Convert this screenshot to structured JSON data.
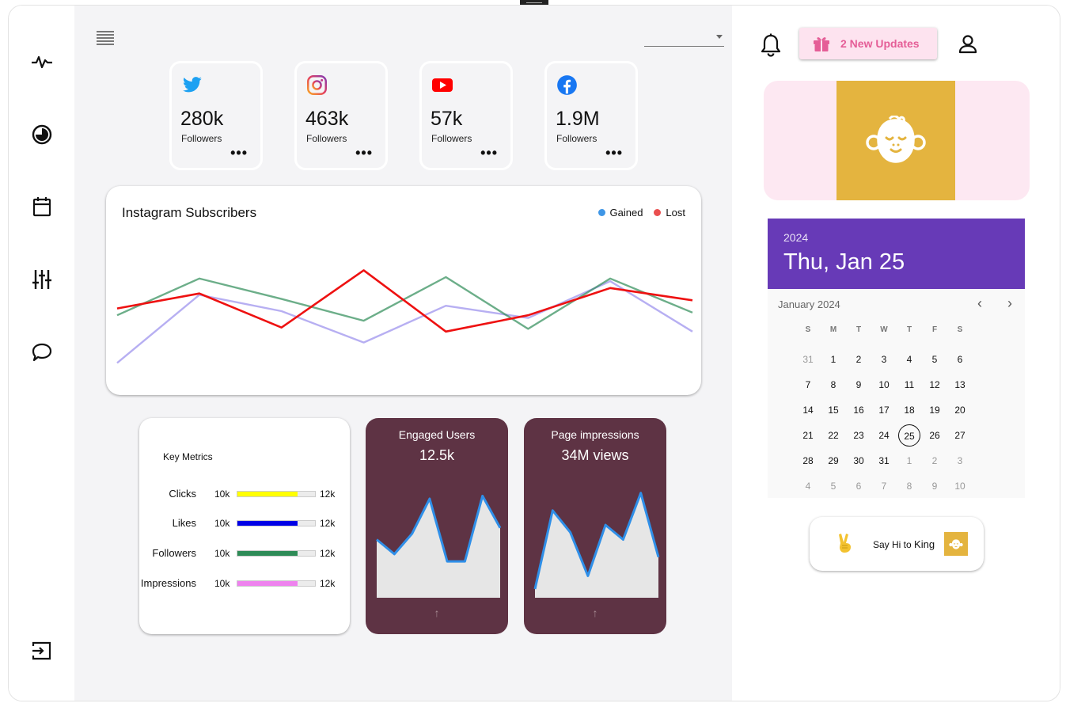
{
  "colors": {
    "accent": "#673ab7",
    "pink": "#e55e97",
    "card_dark": "#5e3344",
    "gold": "#e4b43f"
  },
  "sidebar": {
    "items": [
      "activity-icon",
      "pie-chart-icon",
      "calendar-icon",
      "sliders-icon",
      "chat-icon"
    ],
    "bottom": "logout-icon"
  },
  "header": {
    "select_value": ""
  },
  "social": [
    {
      "network": "twitter-icon",
      "count": "280k",
      "label": "Followers"
    },
    {
      "network": "instagram-icon",
      "count": "463k",
      "label": "Followers"
    },
    {
      "network": "youtube-icon",
      "count": "57k",
      "label": "Followers"
    },
    {
      "network": "facebook-icon",
      "count": "1.9M",
      "label": "Followers"
    }
  ],
  "subscribers": {
    "title": "Instagram Subscribers",
    "legend": [
      {
        "name": "Gained",
        "color": "#3f96e6"
      },
      {
        "name": "Lost",
        "color": "#ea4f4f"
      }
    ]
  },
  "chart_data": {
    "type": "line",
    "title": "Instagram Subscribers",
    "x": [
      0,
      1,
      2,
      3,
      4,
      5,
      6,
      7
    ],
    "ylim": [
      0,
      100
    ],
    "series": [
      {
        "color": "#7b6ee8",
        "values": [
          5,
          55,
          43,
          20,
          47,
          38,
          65,
          28
        ]
      },
      {
        "color": "#2e8b57",
        "values": [
          40,
          67,
          52,
          36,
          68,
          30,
          67,
          42
        ]
      },
      {
        "color": "#ee1111",
        "values": [
          45,
          56,
          31,
          73,
          28,
          40,
          60,
          51
        ]
      }
    ]
  },
  "metrics": {
    "title": "Key Metrics",
    "rows": [
      {
        "name": "Clicks",
        "min": "10k",
        "max": "12k",
        "value": 0.78,
        "color": "#ffff00"
      },
      {
        "name": "Likes",
        "min": "10k",
        "max": "12k",
        "value": 0.78,
        "color": "#0000e6"
      },
      {
        "name": "Followers",
        "min": "10k",
        "max": "12k",
        "value": 0.78,
        "color": "#2e8b57"
      },
      {
        "name": "Impressions",
        "min": "10k",
        "max": "12k",
        "value": 0.78,
        "color": "#ee82ee"
      }
    ]
  },
  "engaged": {
    "title": "Engaged Users",
    "value": "12.5k",
    "spark": [
      40,
      30,
      44,
      68,
      25,
      25,
      70,
      48
    ]
  },
  "impressions": {
    "title": "Page impressions",
    "value": "34M views",
    "spark": [
      6,
      60,
      45,
      15,
      50,
      40,
      72,
      28
    ]
  },
  "updates": {
    "label": "2 New Updates"
  },
  "calendar": {
    "year": "2024",
    "date": "Thu, Jan 25",
    "month": "January 2024",
    "prev": "‹",
    "next": "›",
    "dow": [
      "S",
      "M",
      "T",
      "W",
      "T",
      "F",
      "S"
    ],
    "days": [
      [
        "31",
        "1",
        "2",
        "3",
        "4",
        "5",
        "6"
      ],
      [
        "7",
        "8",
        "9",
        "10",
        "11",
        "12",
        "13"
      ],
      [
        "14",
        "15",
        "16",
        "17",
        "18",
        "19",
        "20"
      ],
      [
        "21",
        "22",
        "23",
        "24",
        "25",
        "26",
        "27"
      ],
      [
        "28",
        "29",
        "30",
        "31",
        "1",
        "2",
        "3"
      ],
      [
        "4",
        "5",
        "6",
        "7",
        "8",
        "9",
        "10"
      ]
    ],
    "selected": "25"
  },
  "sayhi": {
    "prefix": "Say Hi to ",
    "name": "King"
  }
}
